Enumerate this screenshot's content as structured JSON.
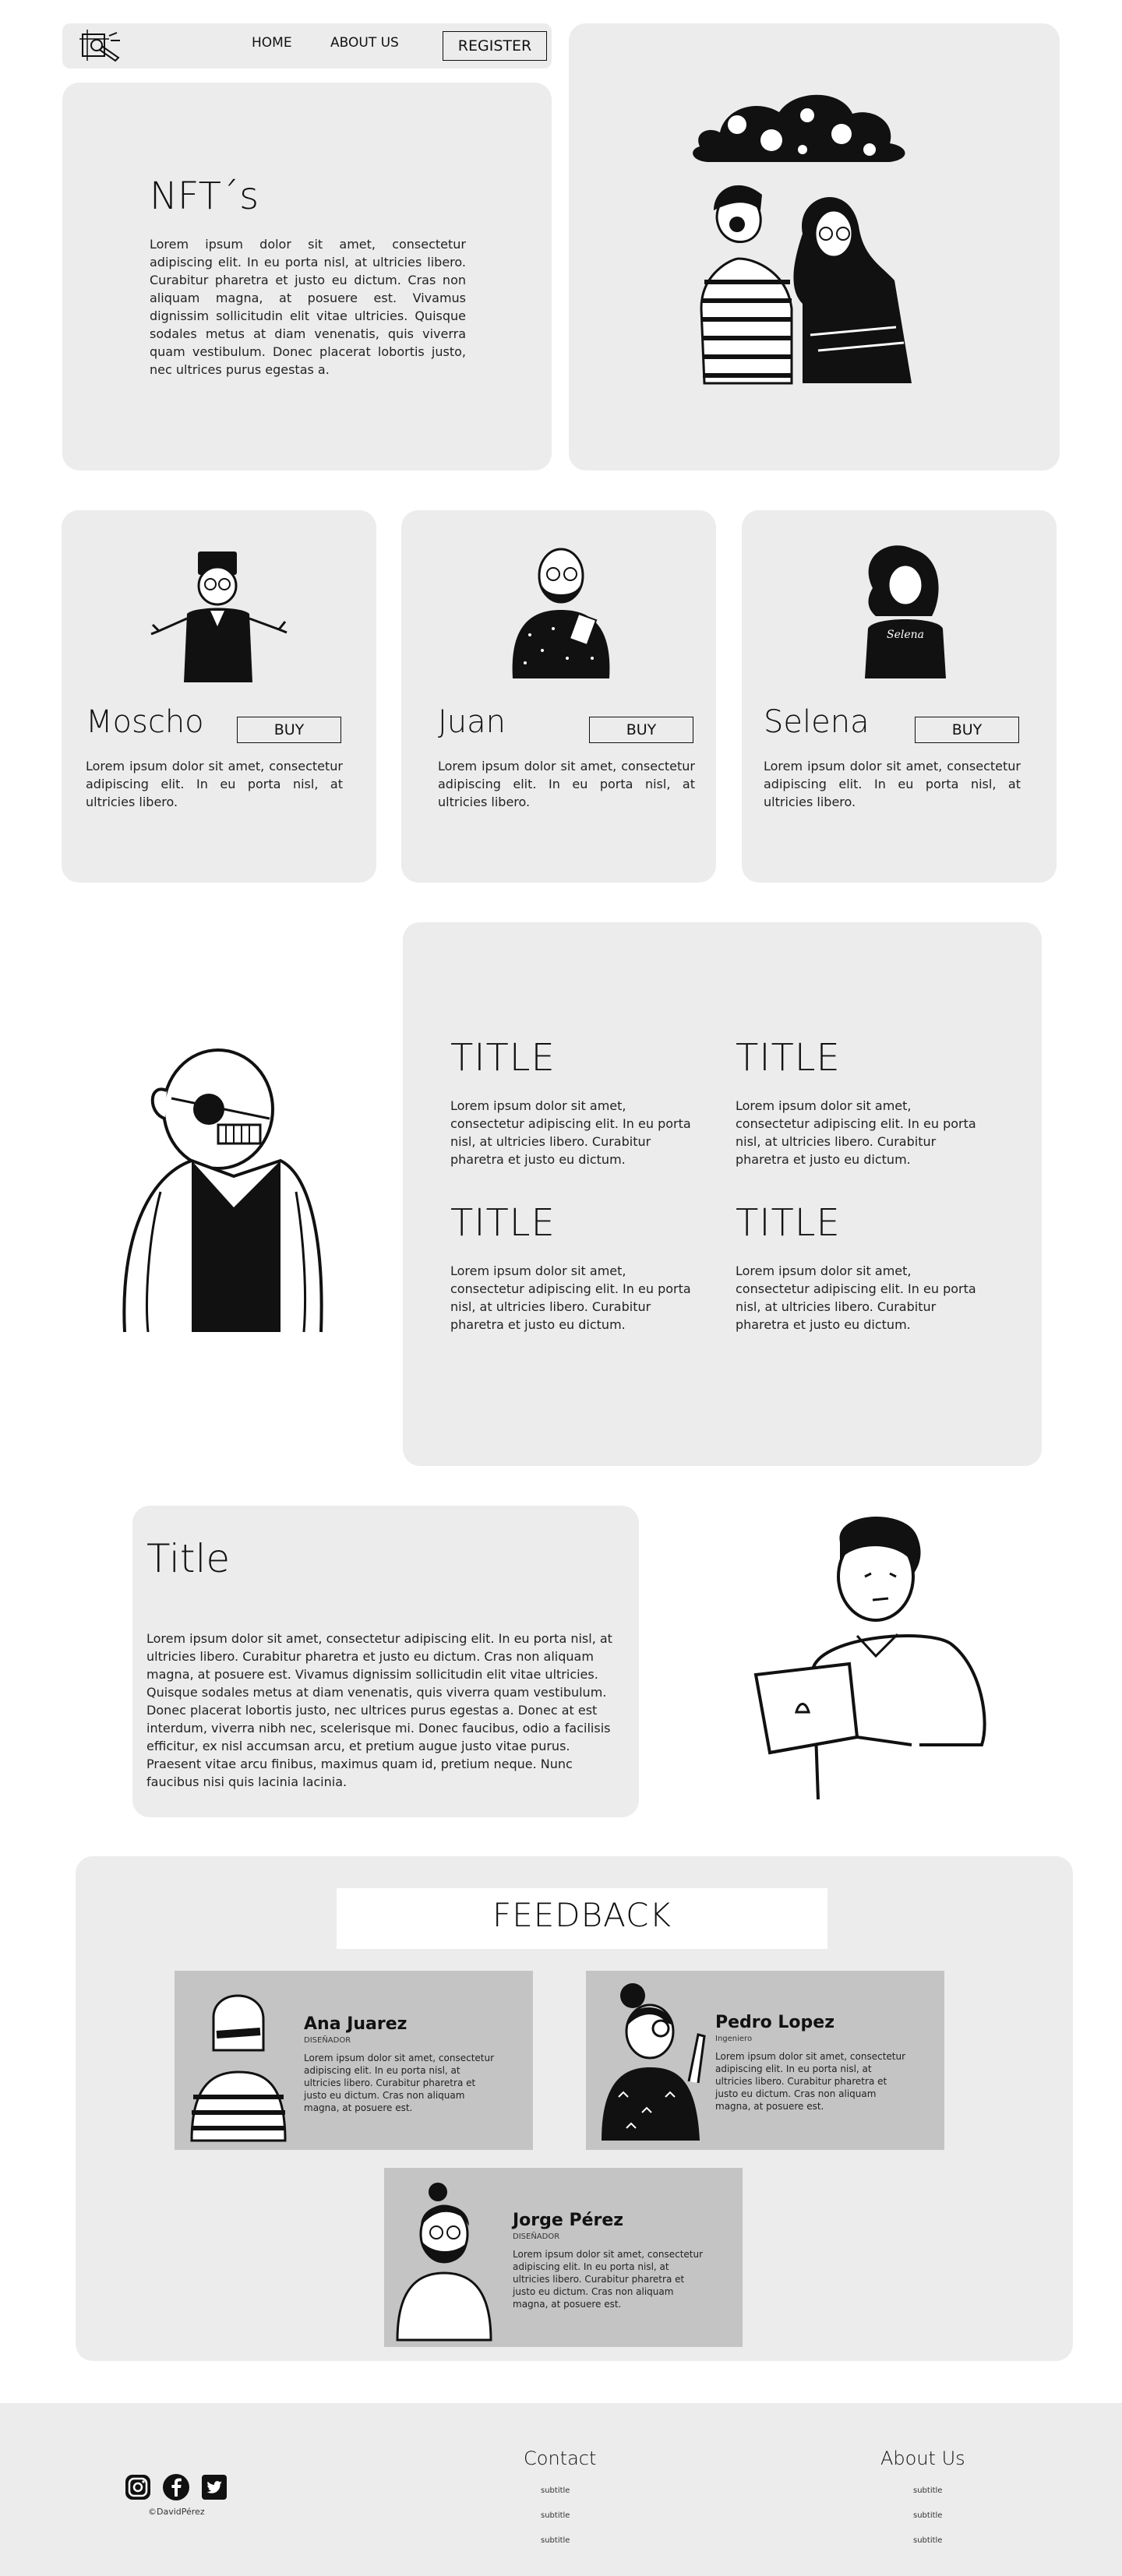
{
  "nav": {
    "home": "HOME",
    "about": "ABOUT US",
    "register": "REGISTER"
  },
  "hero": {
    "title": "NFT´s",
    "text": "Lorem ipsum dolor sit amet, consectetur adipiscing elit. In eu porta nisl, at ultricies libero. Curabitur pharetra et justo eu dictum. Cras non aliquam magna, at posuere est. Vivamus dignissim sollicitudin elit vitae ultricies. Quisque sodales metus at diam venenatis, quis viverra quam vestibulum. Donec placerat lobortis justo, nec ultrices purus egestas a."
  },
  "cards": [
    {
      "name": "Moscho",
      "buy": "BUY",
      "text": "Lorem ipsum dolor sit amet, consectetur adipiscing elit. In eu porta nisl, at ultricies libero."
    },
    {
      "name": "Juan",
      "buy": "BUY",
      "text": "Lorem ipsum dolor sit amet, consectetur adipiscing elit. In eu porta nisl, at ultricies libero."
    },
    {
      "name": "Selena",
      "buy": "BUY",
      "text": "Lorem ipsum dolor sit amet, consectetur adipiscing elit. In eu porta nisl, at ultricies libero.",
      "shirt": "Selena"
    }
  ],
  "features": [
    {
      "title": "TITLE",
      "text": "Lorem ipsum dolor sit amet, consectetur adipiscing elit. In eu porta nisl, at ultricies libero. Curabitur pharetra et justo eu dictum."
    },
    {
      "title": "TITLE",
      "text": "Lorem ipsum dolor sit amet, consectetur adipiscing elit. In eu porta nisl, at ultricies libero. Curabitur pharetra et justo eu dictum."
    },
    {
      "title": "TITLE",
      "text": "Lorem ipsum dolor sit amet, consectetur adipiscing elit. In eu porta nisl, at ultricies libero. Curabitur pharetra et justo eu dictum."
    },
    {
      "title": "TITLE",
      "text": "Lorem ipsum dolor sit amet, consectetur adipiscing elit. In eu porta nisl, at ultricies libero. Curabitur pharetra et justo eu dictum."
    }
  ],
  "info": {
    "title": "Title",
    "text": "Lorem ipsum dolor sit amet, consectetur adipiscing elit. In eu porta nisl, at ultricies libero. Curabitur pharetra et justo eu dictum. Cras non aliquam magna, at posuere est. Vivamus dignissim sollicitudin elit vitae ultricies. Quisque sodales metus at diam venenatis, quis viverra quam vestibulum. Donec placerat lobortis justo, nec ultrices purus egestas a. Donec at est interdum, viverra nibh nec, scelerisque mi. Donec faucibus, odio a facilisis efficitur, ex nisl accumsan arcu, et pretium augue justo vitae purus. Praesent vitae arcu finibus, maximus quam id, pretium neque. Nunc faucibus nisi quis lacinia lacinia."
  },
  "feedback": {
    "heading": "FEEDBACK",
    "items": [
      {
        "name": "Ana Juarez",
        "role": "DISEÑADOR",
        "text": "Lorem ipsum dolor sit amet, consectetur adipiscing elit. In eu porta nisl, at ultricies libero. Curabitur pharetra et justo eu dictum. Cras non aliquam magna, at posuere est."
      },
      {
        "name": "Pedro Lopez",
        "role": "Ingeniero",
        "text": "Lorem ipsum dolor sit amet, consectetur adipiscing elit. In eu porta nisl, at ultricies libero. Curabitur pharetra et justo eu dictum. Cras non aliquam magna, at posuere est."
      },
      {
        "name": "Jorge Pérez",
        "role": "DISEÑADOR",
        "text": "Lorem ipsum dolor sit amet, consectetur adipiscing elit. In eu porta nisl, at ultricies libero. Curabitur pharetra et justo eu dictum. Cras non aliquam magna, at posuere est."
      }
    ]
  },
  "footer": {
    "copyright": "©DavidPérez",
    "contact": {
      "title": "Contact",
      "links": [
        "subtitle",
        "subtitle",
        "subtitle"
      ]
    },
    "about": {
      "title": "About Us",
      "links": [
        "subtitle",
        "subtitle",
        "subtitle"
      ]
    },
    "social_icons": [
      "instagram-icon",
      "facebook-icon",
      "twitter-icon"
    ]
  },
  "colors": {
    "panel": "#ececec",
    "feedback_card": "#c4c4c4",
    "ink": "#111111",
    "background": "#ffffff"
  }
}
